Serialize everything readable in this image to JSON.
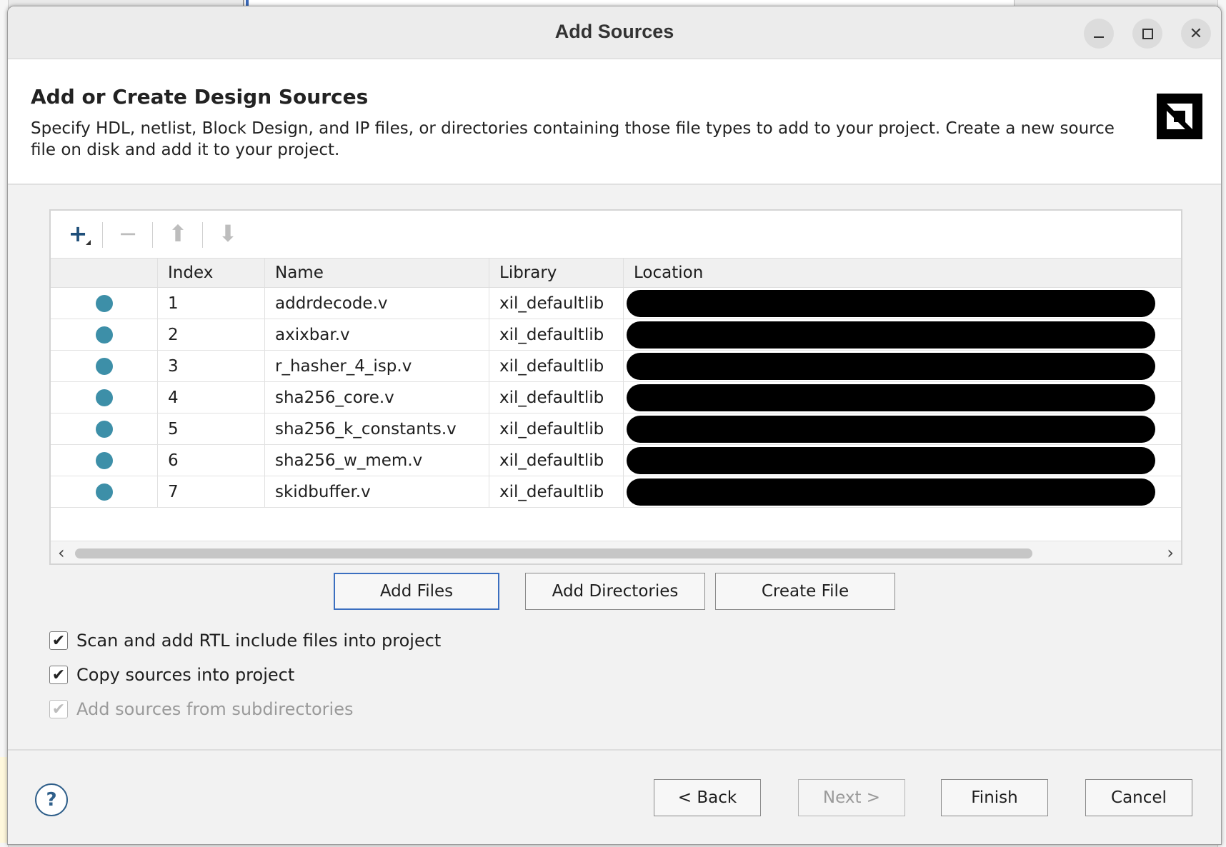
{
  "window": {
    "title": "Add Sources"
  },
  "header": {
    "title": "Add or Create Design Sources",
    "description": "Specify HDL, netlist, Block Design, and IP files, or directories containing those file types to add to your project. Create a new source file on disk and add it to your project."
  },
  "toolbar": {
    "add": "+",
    "remove": "−",
    "move_up": "⬆",
    "move_down": "⬇"
  },
  "table": {
    "columns": {
      "index": "Index",
      "name": "Name",
      "library": "Library",
      "location": "Location"
    },
    "rows": [
      {
        "index": "1",
        "name": "addrdecode.v",
        "library": "xil_defaultlib"
      },
      {
        "index": "2",
        "name": "axixbar.v",
        "library": "xil_defaultlib"
      },
      {
        "index": "3",
        "name": "r_hasher_4_isp.v",
        "library": "xil_defaultlib"
      },
      {
        "index": "4",
        "name": "sha256_core.v",
        "library": "xil_defaultlib"
      },
      {
        "index": "5",
        "name": "sha256_k_constants.v",
        "library": "xil_defaultlib"
      },
      {
        "index": "6",
        "name": "sha256_w_mem.v",
        "library": "xil_defaultlib"
      },
      {
        "index": "7",
        "name": "skidbuffer.v",
        "library": "xil_defaultlib"
      }
    ]
  },
  "buttons": {
    "add_files": "Add Files",
    "add_directories": "Add Directories",
    "create_file": "Create File",
    "back": "< Back",
    "next": "Next >",
    "finish": "Finish",
    "cancel": "Cancel",
    "help": "?"
  },
  "options": {
    "scan_rtl": "Scan and add RTL include files into project",
    "copy_sources": "Copy sources into project",
    "add_subdirs": "Add sources from subdirectories"
  },
  "colors": {
    "status_dot": "#3d8fa8",
    "focus_border": "#3b6fc0"
  }
}
